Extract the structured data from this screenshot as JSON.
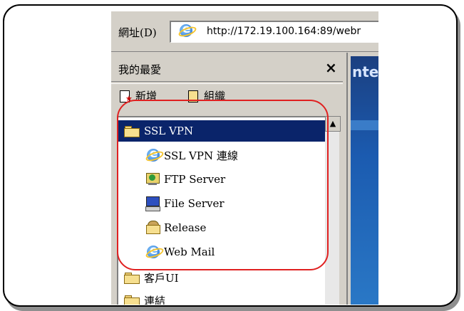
{
  "address_bar": {
    "label": "網址(D)",
    "url": "http://172.19.100.164:89/webr"
  },
  "favorites": {
    "title": "我的最愛",
    "close": "×",
    "toolbar": {
      "add_label": "新增",
      "organize_label": "組織"
    },
    "items": [
      {
        "label": "SSL VPN",
        "icon": "folder-icon",
        "selected": true
      },
      {
        "label": "SSL VPN 連線",
        "icon": "ie-icon"
      },
      {
        "label": "FTP Server",
        "icon": "ftp-globe-icon"
      },
      {
        "label": "File Server",
        "icon": "computer-icon"
      },
      {
        "label": "Release",
        "icon": "shared-folder-icon"
      },
      {
        "label": "Web Mail",
        "icon": "ie-icon"
      },
      {
        "label": "客戶UI",
        "icon": "folder-icon"
      },
      {
        "label": "連結",
        "icon": "folder-icon"
      }
    ]
  },
  "content_preview_text": "nte",
  "colors": {
    "selection": "#0a246a",
    "highlight_ring": "#e02020"
  }
}
